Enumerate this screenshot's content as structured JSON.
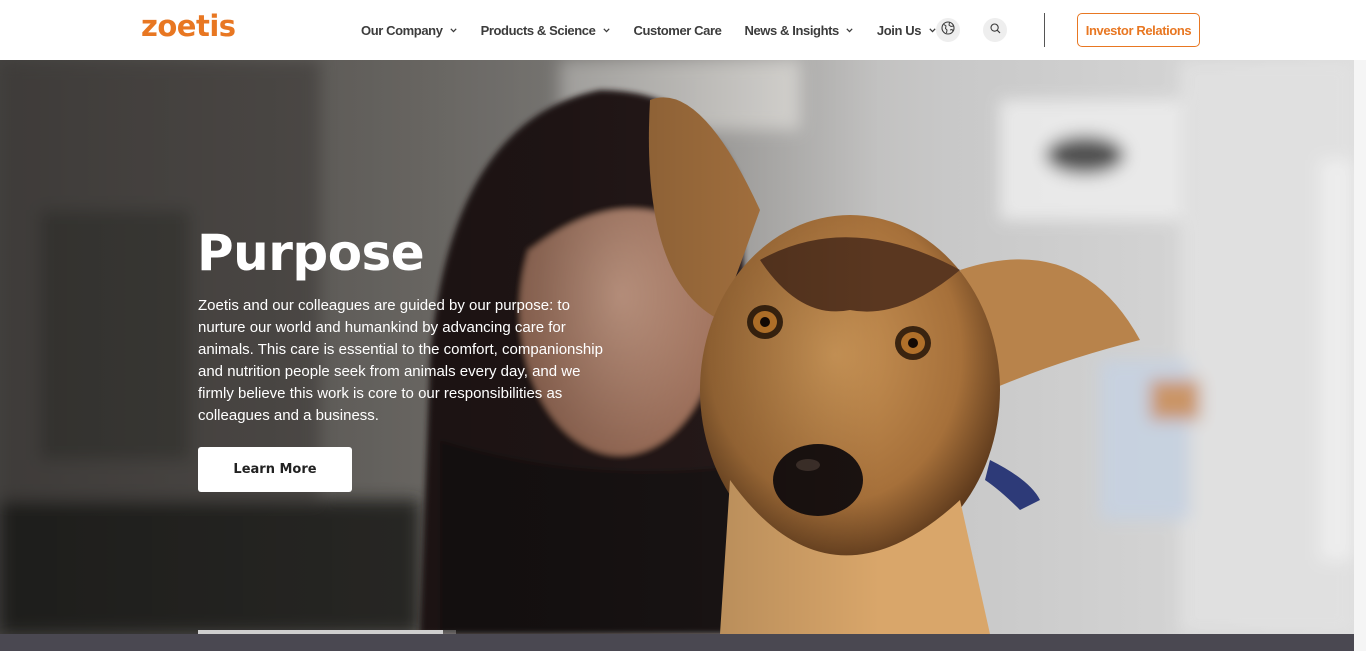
{
  "header": {
    "logo_text": "zoetis",
    "nav": [
      {
        "label": "Our Company",
        "has_dropdown": true
      },
      {
        "label": "Products & Science",
        "has_dropdown": true
      },
      {
        "label": "Customer Care",
        "has_dropdown": false
      },
      {
        "label": "News & Insights",
        "has_dropdown": true
      },
      {
        "label": "Join Us",
        "has_dropdown": true
      }
    ],
    "icons": [
      "globe-icon",
      "search-icon"
    ],
    "investor_label": "Investor Relations"
  },
  "hero": {
    "title": "Purpose",
    "body": "Zoetis and our colleagues are guided by our purpose: to nurture our world and humankind by advancing care for animals. This care is essential to the comfort, companionship and nutrition people seek from animals every day, and we firmly believe this work is core to our responsibilities as colleagues and a business.",
    "cta_label": "Learn More",
    "slide_progress": 0.95
  },
  "colors": {
    "brand": "#e87722",
    "nav_text": "#3c3c3c",
    "bottom_strip": "#4a4851"
  }
}
